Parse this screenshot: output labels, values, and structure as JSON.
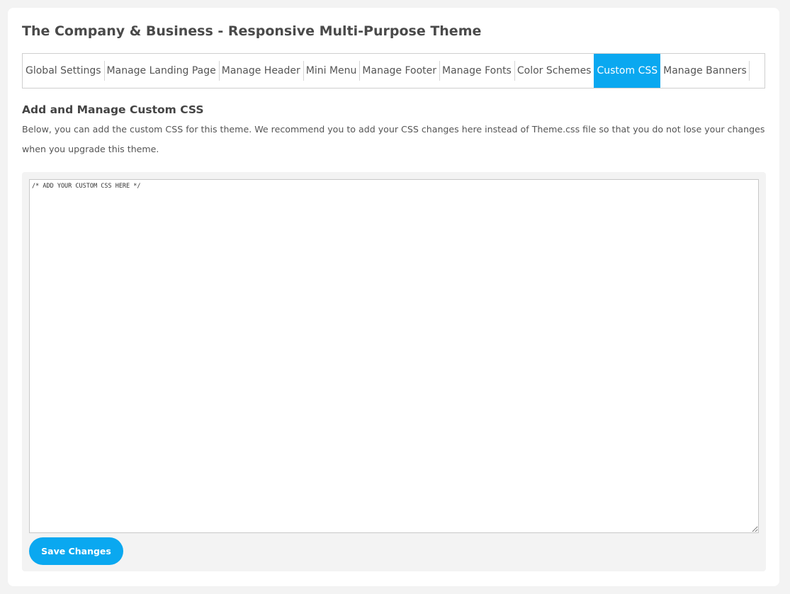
{
  "header": {
    "title": "The Company & Business - Responsive Multi-Purpose Theme"
  },
  "tabs": [
    {
      "label": "Global Settings",
      "active": false
    },
    {
      "label": "Manage Landing Page",
      "active": false
    },
    {
      "label": "Manage Header",
      "active": false
    },
    {
      "label": "Mini Menu",
      "active": false
    },
    {
      "label": "Manage Footer",
      "active": false
    },
    {
      "label": "Manage Fonts",
      "active": false
    },
    {
      "label": "Color Schemes",
      "active": false
    },
    {
      "label": "Custom CSS",
      "active": true
    },
    {
      "label": "Manage Banners",
      "active": false
    }
  ],
  "section": {
    "title": "Add and Manage Custom CSS",
    "description": "Below, you can add the custom CSS for this theme. We recommend you to add your CSS changes here instead of Theme.css file so that you do not lose your changes when you upgrade this theme."
  },
  "editor": {
    "value": "/* ADD YOUR CUSTOM CSS HERE */"
  },
  "actions": {
    "save_label": "Save Changes"
  },
  "colors": {
    "accent": "#0aa8f0",
    "page_background": "#f3f3f3",
    "card_background": "#ffffff"
  }
}
